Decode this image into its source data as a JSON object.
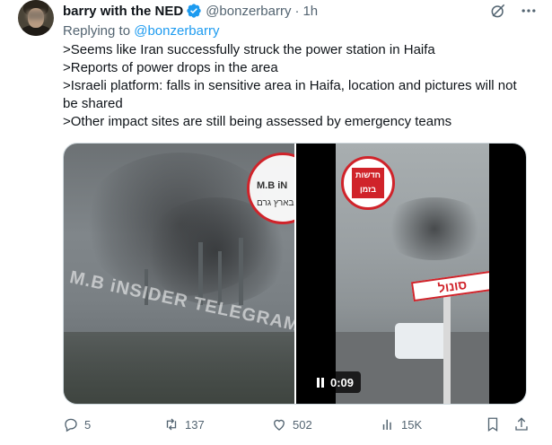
{
  "tweet": {
    "display_name": "barry with the NED",
    "handle": "@bonzerbarry",
    "separator": "·",
    "time": "1h",
    "replying_prefix": "Replying to",
    "replying_to": "@bonzerbarry",
    "lines": [
      ">Seems like Iran successfully struck the power station in Haifa",
      ">Reports of power drops in the area",
      ">Israeli platform: falls in sensitive area in Haifa, location and pictures will not be shared",
      ">Other impact sites are still being assessed by emergency teams"
    ]
  },
  "media": {
    "left_watermark": "M.B iNSIDER TELEGRAM",
    "left_badge_title": "M.B iN",
    "left_badge_sub": "ים בארץ גרם",
    "right_badge_text": "חדשות בזמן",
    "right_sign_text": "סונול",
    "video_time": "0:09"
  },
  "actions": {
    "replies": "5",
    "retweets": "137",
    "likes": "502",
    "views": "15K"
  },
  "colors": {
    "accent": "#1d9bf0",
    "muted": "#536471",
    "text": "#0f1419",
    "badge_red": "#d0232a"
  }
}
